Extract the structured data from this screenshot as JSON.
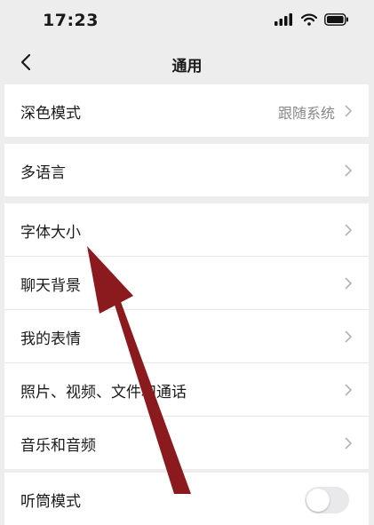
{
  "status_bar": {
    "time": "17:23",
    "icons": [
      "signal-icon",
      "wifi-icon",
      "battery-icon"
    ]
  },
  "nav": {
    "title": "通用",
    "back_icon": "chevron-left-icon"
  },
  "dark_mode": {
    "label": "深色模式",
    "value": "跟随系统"
  },
  "language": {
    "label": "多语言"
  },
  "settings": [
    {
      "label": "字体大小"
    },
    {
      "label": "聊天背景"
    },
    {
      "label": "我的表情"
    },
    {
      "label": "照片、视频、文件和通话"
    },
    {
      "label": "音乐和音频"
    }
  ],
  "partial_row": {
    "label": "听筒模式",
    "toggle_on": false
  },
  "annotation": {
    "color": "#8b1a1e",
    "icon": "arrow-annotation"
  },
  "colors": {
    "background": "#ededed",
    "card": "#ffffff",
    "secondary_text": "#888888"
  }
}
